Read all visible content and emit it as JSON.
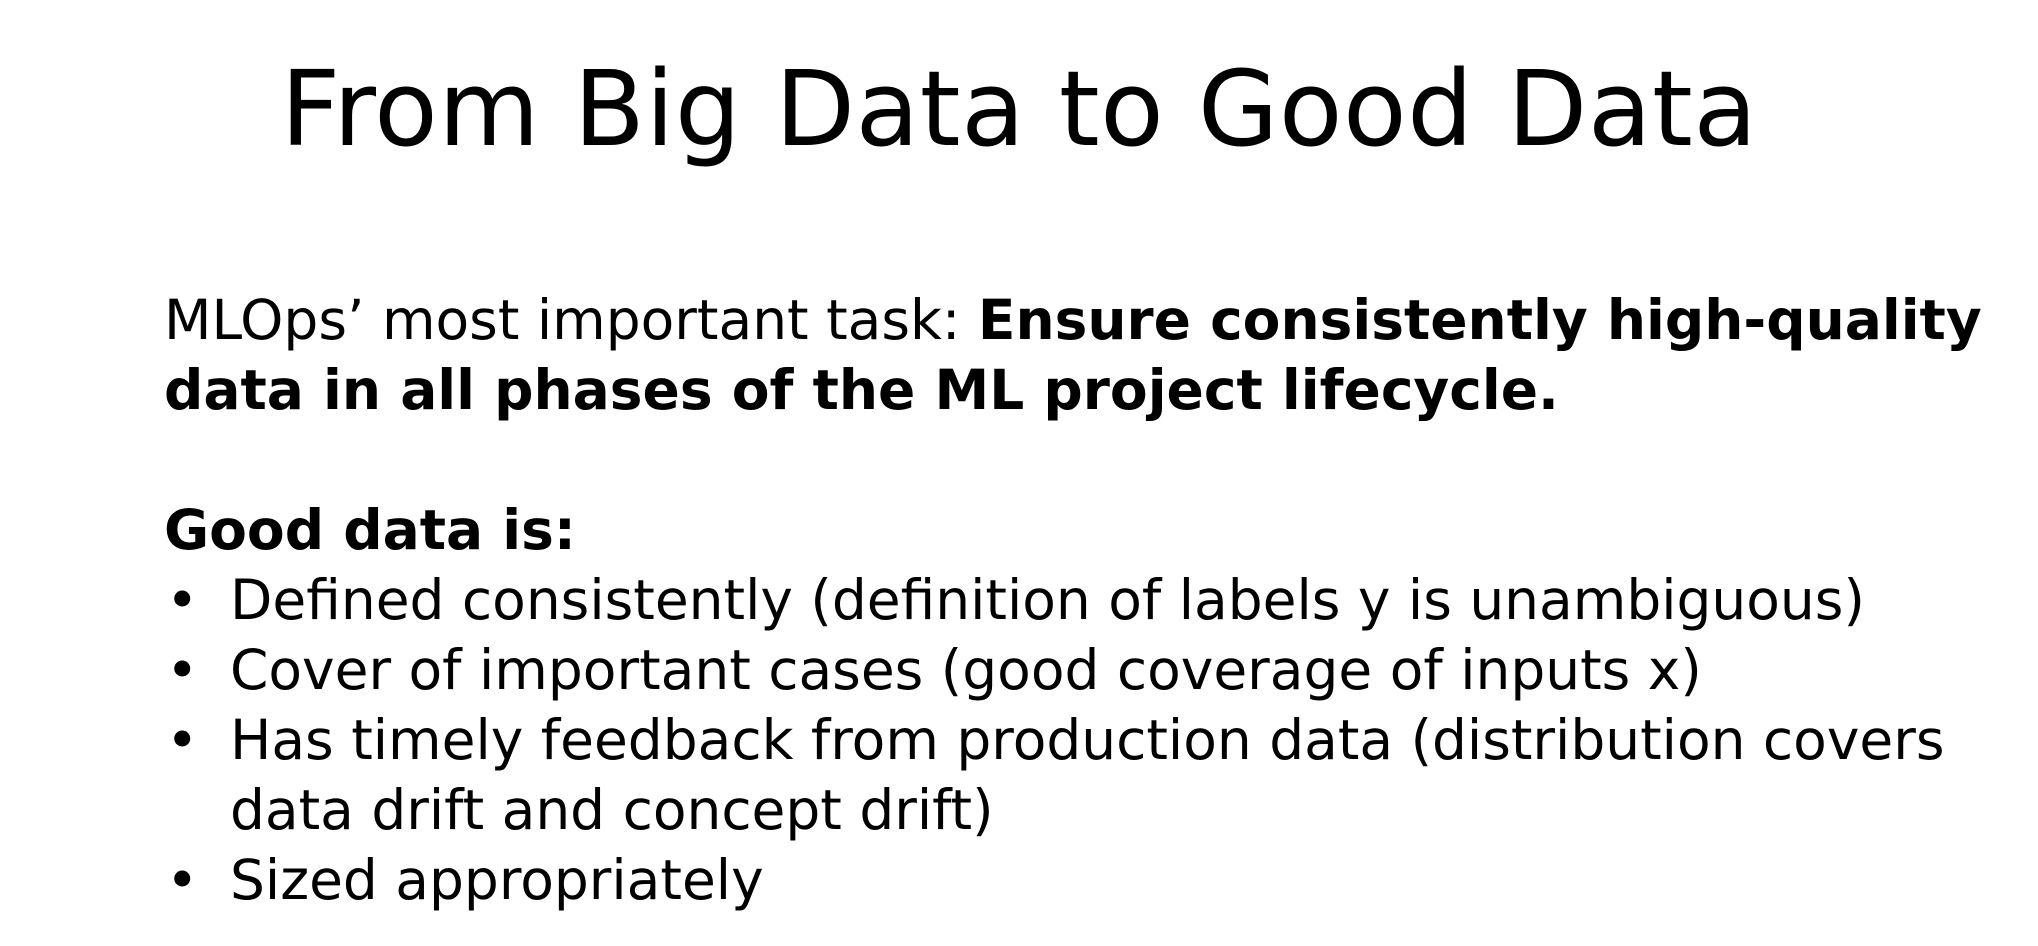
{
  "slide": {
    "title": "From Big Data to Good Data",
    "intro": {
      "lead": "MLOps’ most important task: ",
      "emphasis": "Ensure consistently high-quality data in all phases of the ML project lifecycle."
    },
    "subheading": "Good data is:",
    "bullet_symbol": "•",
    "bullets": [
      "Defined consistently (definition of labels y is unambiguous)",
      "Cover of important cases (good coverage of inputs x)",
      "Has timely feedback from production data (distribution covers data drift and concept drift)",
      "Sized appropriately"
    ]
  }
}
